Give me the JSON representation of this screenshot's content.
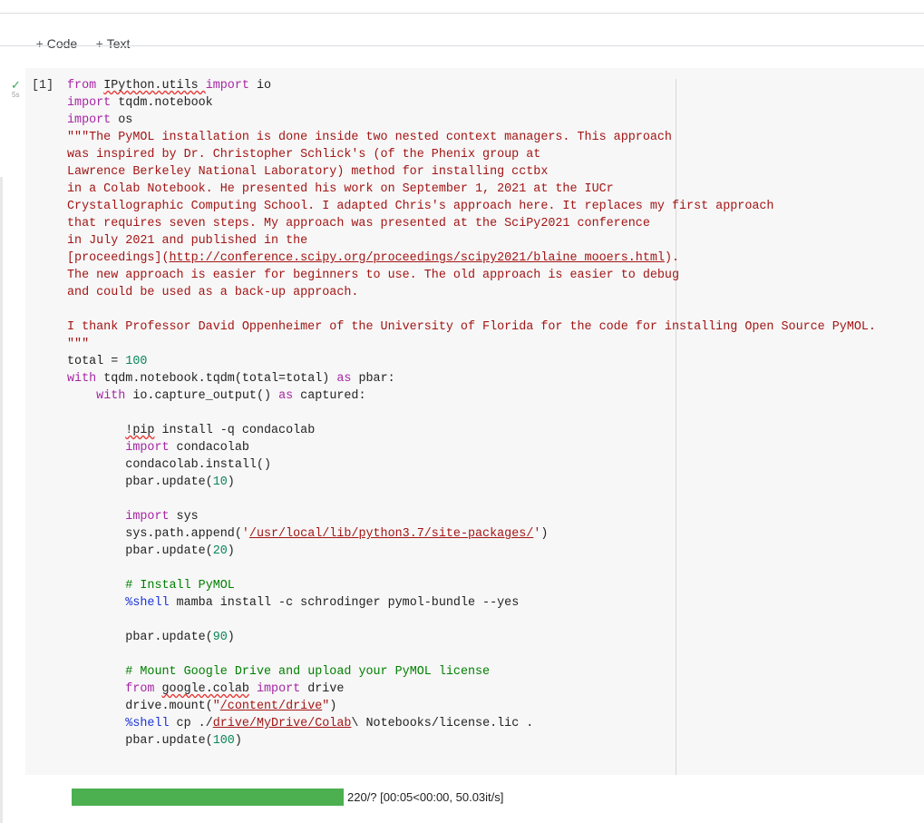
{
  "toolbar": {
    "add_code_label": "Code",
    "add_text_label": "Text",
    "plus_icon": "plus-icon"
  },
  "cell": {
    "execution_count": "[1]",
    "status_icon": "check-icon",
    "run_time": "5s",
    "code_lines": [
      [
        {
          "c": "kw",
          "t": "from "
        },
        {
          "t": "",
          "s": "IPython.utils "
        },
        {
          "t": ""
        },
        {
          "c": "kw",
          "t": "import"
        },
        {
          "t": " io"
        }
      ],
      [
        {
          "c": "kw",
          "t": "import"
        },
        {
          "t": " tqdm.notebook"
        }
      ],
      [
        {
          "c": "kw",
          "t": "import"
        },
        {
          "t": " os"
        }
      ],
      [
        {
          "c": "str",
          "t": "\"\"\"The PyMOL installation is done inside two nested context managers. This approach"
        }
      ],
      [
        {
          "c": "str",
          "t": "was inspired by Dr. Christopher Schlick's (of the Phenix group at"
        }
      ],
      [
        {
          "c": "str",
          "t": "Lawrence Berkeley National Laboratory) method for installing cctbx"
        }
      ],
      [
        {
          "c": "str",
          "t": "in a Colab Notebook. He presented his work on September 1, 2021 at the IUCr"
        }
      ],
      [
        {
          "c": "str",
          "t": "Crystallographic Computing School. I adapted Chris's approach here. It replaces my first approach"
        }
      ],
      [
        {
          "c": "str",
          "t": "that requires seven steps. My approach was presented at the SciPy2021 conference"
        }
      ],
      [
        {
          "c": "str",
          "t": "in July 2021 and published in the"
        }
      ],
      [
        {
          "c": "str",
          "t": "[proceedings]("
        },
        {
          "c": "url",
          "t": "http://conference.scipy.org/proceedings/scipy2021/blaine_mooers.html"
        },
        {
          "c": "str",
          "t": ")."
        }
      ],
      [
        {
          "c": "str",
          "t": "The new approach is easier for beginners to use. The old approach is easier to debug"
        }
      ],
      [
        {
          "c": "str",
          "t": "and could be used as a back-up approach."
        }
      ],
      [],
      [
        {
          "c": "str",
          "t": "I thank Professor David Oppenheimer of the University of Florida for the code for installing Open Source PyMOL."
        }
      ],
      [
        {
          "c": "str",
          "t": "\"\"\""
        }
      ],
      [
        {
          "t": "total = "
        },
        {
          "c": "num",
          "t": "100"
        }
      ],
      [
        {
          "c": "kw",
          "t": "with"
        },
        {
          "t": " tqdm.notebook.tqdm(total=total) "
        },
        {
          "c": "kw",
          "t": "as"
        },
        {
          "t": " pbar:"
        }
      ],
      [
        {
          "t": "    "
        },
        {
          "c": "kw",
          "t": "with"
        },
        {
          "t": " io.capture_output() "
        },
        {
          "c": "kw",
          "t": "as"
        },
        {
          "t": " captured:"
        }
      ],
      [],
      [
        {
          "t": "        "
        },
        {
          "t": "",
          "s": "!pip"
        },
        {
          "t": " install -q condacolab"
        }
      ],
      [
        {
          "t": "        "
        },
        {
          "c": "kw",
          "t": "import"
        },
        {
          "t": " condacolab"
        }
      ],
      [
        {
          "t": "        condacolab.install()"
        }
      ],
      [
        {
          "t": "        pbar.update("
        },
        {
          "c": "num",
          "t": "10"
        },
        {
          "t": ")"
        }
      ],
      [],
      [
        {
          "t": "        "
        },
        {
          "c": "kw",
          "t": "import"
        },
        {
          "t": " sys"
        }
      ],
      [
        {
          "t": "        sys.path.append("
        },
        {
          "c": "str",
          "t": "'"
        },
        {
          "c": "url",
          "t": "/usr/local/lib/python3.7/site-packages/"
        },
        {
          "c": "str",
          "t": "'"
        },
        {
          "t": ")"
        }
      ],
      [
        {
          "t": "        pbar.update("
        },
        {
          "c": "num",
          "t": "20"
        },
        {
          "t": ")"
        }
      ],
      [],
      [
        {
          "t": "        "
        },
        {
          "c": "com",
          "t": "# Install PyMOL"
        }
      ],
      [
        {
          "t": "        "
        },
        {
          "c": "mag",
          "t": "%shell"
        },
        {
          "t": " mamba install -c schrodinger pymol-bundle --yes"
        }
      ],
      [],
      [
        {
          "t": "        pbar.update("
        },
        {
          "c": "num",
          "t": "90"
        },
        {
          "t": ")"
        }
      ],
      [],
      [
        {
          "t": "        "
        },
        {
          "c": "com",
          "t": "# Mount Google Drive and upload your PyMOL license"
        }
      ],
      [
        {
          "t": "        "
        },
        {
          "c": "kw",
          "t": "from"
        },
        {
          "t": " "
        },
        {
          "t": "",
          "s": "google.colab"
        },
        {
          "t": " "
        },
        {
          "c": "kw",
          "t": "import"
        },
        {
          "t": " drive"
        }
      ],
      [
        {
          "t": "        drive.mount("
        },
        {
          "c": "str",
          "t": "\""
        },
        {
          "c": "url",
          "t": "/content/drive"
        },
        {
          "c": "str",
          "t": "\""
        },
        {
          "t": ")"
        }
      ],
      [
        {
          "t": "        "
        },
        {
          "c": "mag",
          "t": "%shell"
        },
        {
          "t": " cp ./"
        },
        {
          "c": "url",
          "t": "drive/MyDrive/Colab"
        },
        {
          "t": "\\ Notebooks/license.lic ."
        }
      ],
      [
        {
          "t": "        pbar.update("
        },
        {
          "c": "num",
          "t": "100"
        },
        {
          "t": ")"
        }
      ]
    ]
  },
  "output": {
    "progress_value": 1.0,
    "progress_text": "220/? [00:05<00:00, 50.03it/s]",
    "bar_color": "#4caf50"
  }
}
